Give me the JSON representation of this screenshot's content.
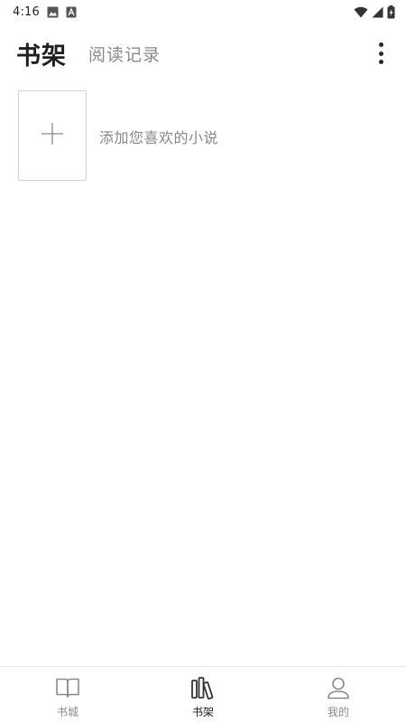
{
  "status_bar": {
    "time": "4:16",
    "left_icons": [
      "image-icon",
      "a-letter-icon"
    ],
    "right_icons": [
      "wifi-icon",
      "signal-icon",
      "battery-charging-icon"
    ]
  },
  "header": {
    "active_tab": "书架",
    "inactive_tab": "阅读记录",
    "more_icon": "more-vertical-icon"
  },
  "shelf": {
    "add_icon": "plus-icon",
    "add_label": "添加您喜欢的小说"
  },
  "bottom_nav": {
    "items": [
      {
        "label": "书城",
        "icon": "open-book-icon",
        "active": false
      },
      {
        "label": "书架",
        "icon": "bookshelf-icon",
        "active": true
      },
      {
        "label": "我的",
        "icon": "user-icon",
        "active": false
      }
    ]
  },
  "colors": {
    "background": "#ffffff",
    "active_text": "#1f1f1f",
    "inactive_text": "#8a8a8a",
    "border": "#d2d2d2"
  }
}
